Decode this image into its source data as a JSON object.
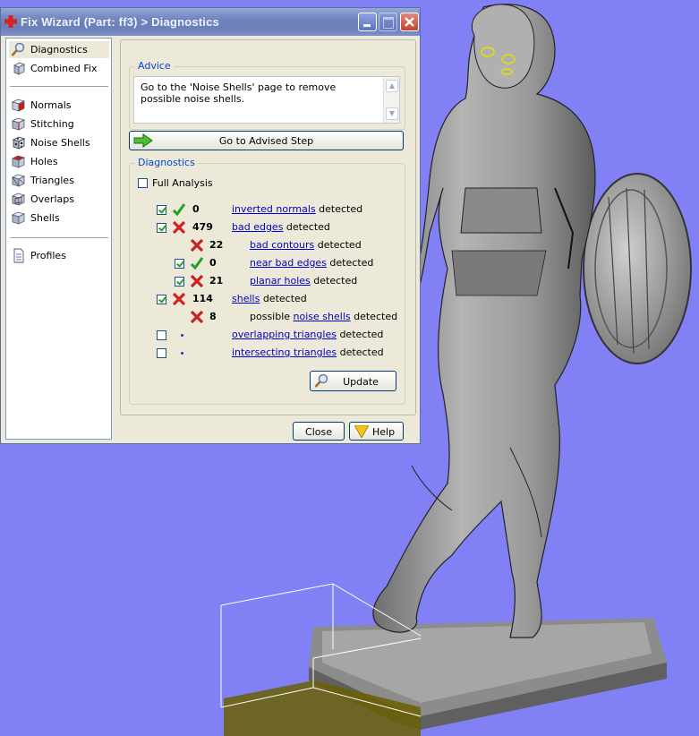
{
  "window": {
    "title": "Fix Wizard (Part: ff3) > Diagnostics"
  },
  "nav": {
    "items": [
      {
        "label": "Diagnostics",
        "icon": "magnifier-icon",
        "selected": true
      },
      {
        "label": "Combined Fix",
        "icon": "combined-fix-icon"
      },
      {
        "label": "Normals",
        "icon": "normals-icon"
      },
      {
        "label": "Stitching",
        "icon": "stitching-icon"
      },
      {
        "label": "Noise Shells",
        "icon": "noise-shells-icon"
      },
      {
        "label": "Holes",
        "icon": "holes-icon"
      },
      {
        "label": "Triangles",
        "icon": "triangles-icon"
      },
      {
        "label": "Overlaps",
        "icon": "overlaps-icon"
      },
      {
        "label": "Shells",
        "icon": "shells-icon"
      },
      {
        "label": "Profiles",
        "icon": "profiles-icon"
      }
    ]
  },
  "advice": {
    "group_title": "Advice",
    "text": "Go to the 'Noise Shells' page to remove possible noise shells."
  },
  "advised_button": {
    "label": "Go to Advised Step"
  },
  "diagnostics": {
    "group_title": "Diagnostics",
    "full_analysis_label": "Full Analysis",
    "full_analysis_checked": false,
    "rows": [
      {
        "checked": true,
        "status": "ok",
        "count": "0",
        "prefix": "",
        "link": "inverted normals",
        "suffix": " detected"
      },
      {
        "checked": true,
        "status": "error",
        "count": "479",
        "prefix": "",
        "link": "bad edges",
        "suffix": " detected"
      },
      {
        "checked": null,
        "status": "error",
        "count": "22",
        "prefix": "",
        "link": "bad contours",
        "suffix": " detected"
      },
      {
        "checked": true,
        "status": "ok",
        "count": "0",
        "prefix": "",
        "link": "near bad edges",
        "suffix": " detected"
      },
      {
        "checked": true,
        "status": "error",
        "count": "21",
        "prefix": "",
        "link": "planar holes",
        "suffix": " detected"
      },
      {
        "checked": true,
        "status": "error",
        "count": "114",
        "prefix": "",
        "link": "shells",
        "suffix": " detected"
      },
      {
        "checked": null,
        "status": "error",
        "count": "8",
        "prefix": "possible ",
        "link": "noise shells",
        "suffix": " detected"
      },
      {
        "checked": false,
        "status": "none",
        "count": "",
        "prefix": "",
        "link": "overlapping triangles",
        "suffix": " detected"
      },
      {
        "checked": false,
        "status": "none",
        "count": "",
        "prefix": "",
        "link": "intersecting triangles",
        "suffix": " detected"
      }
    ],
    "update_label": "Update"
  },
  "footer": {
    "close_label": "Close",
    "help_label": "Help"
  },
  "colors": {
    "viewport_bg": "#8181f5",
    "model_gray": "#9a9a9a",
    "link_blue": "#0000cc",
    "ok_green": "#21a121",
    "error_red": "#cc2222",
    "group_title_blue": "#0046d5"
  }
}
